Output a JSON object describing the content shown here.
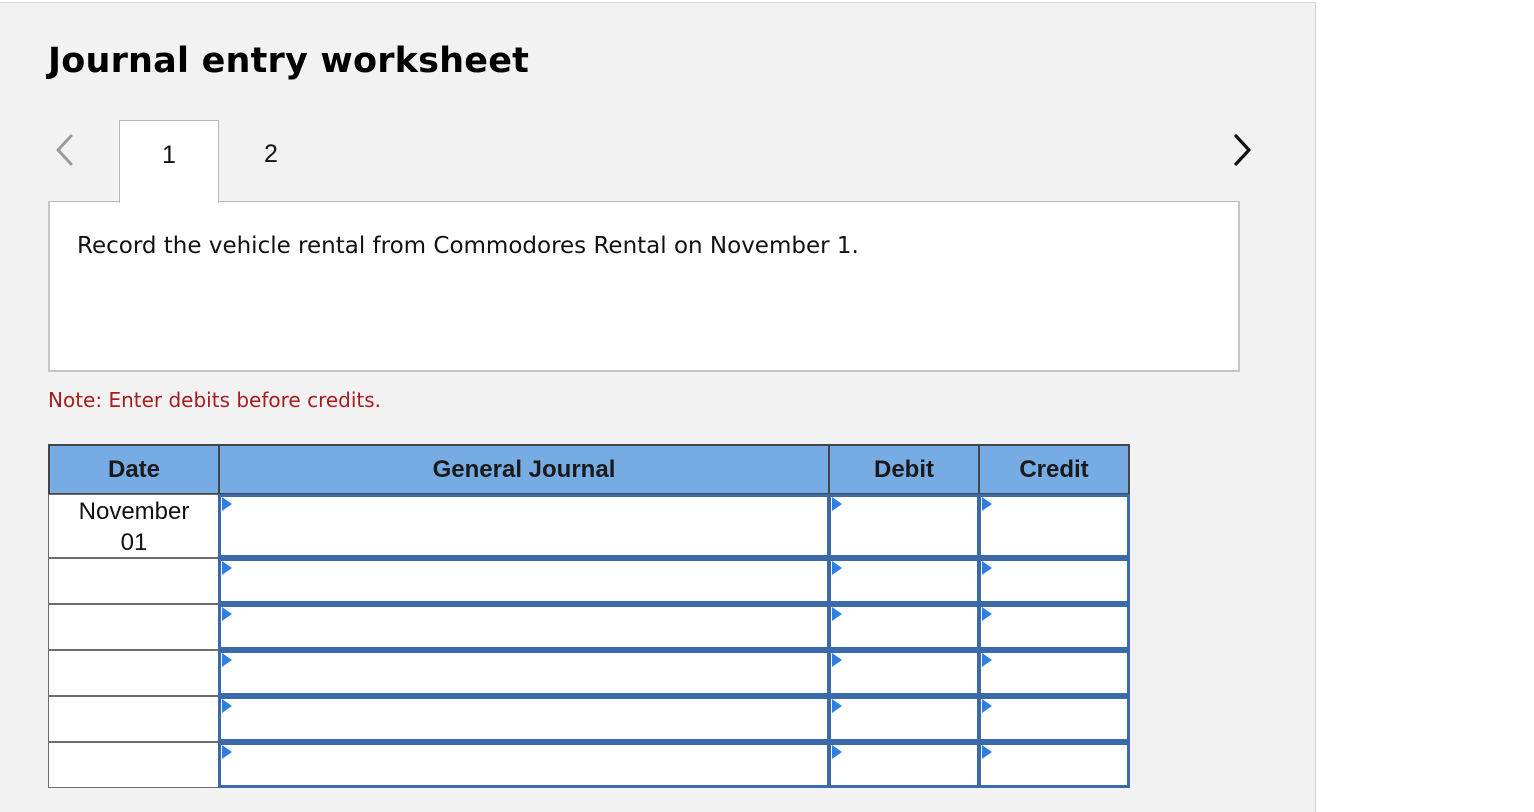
{
  "worksheet": {
    "title": "Journal entry worksheet",
    "tabs": [
      {
        "label": "1",
        "active": true
      },
      {
        "label": "2",
        "active": false
      }
    ],
    "prev_icon": "chevron-left-icon",
    "next_icon": "chevron-right-icon"
  },
  "question": {
    "text": "Record the vehicle rental from Commodores Rental on November 1."
  },
  "note": {
    "text": "Note: Enter debits before credits."
  },
  "journal": {
    "headers": {
      "date": "Date",
      "general_journal": "General Journal",
      "debit": "Debit",
      "credit": "Credit"
    },
    "rows": [
      {
        "date_month": "November",
        "date_day": "01",
        "account": "",
        "debit": "",
        "credit": ""
      },
      {
        "date_month": "",
        "date_day": "",
        "account": "",
        "debit": "",
        "credit": ""
      },
      {
        "date_month": "",
        "date_day": "",
        "account": "",
        "debit": "",
        "credit": ""
      },
      {
        "date_month": "",
        "date_day": "",
        "account": "",
        "debit": "",
        "credit": ""
      },
      {
        "date_month": "",
        "date_day": "",
        "account": "",
        "debit": "",
        "credit": ""
      },
      {
        "date_month": "",
        "date_day": "",
        "account": "",
        "debit": "",
        "credit": ""
      }
    ]
  },
  "colors": {
    "header_bg": "#76abe4",
    "input_border": "#3c6aa8",
    "note_text": "#a71d1d",
    "dropdown_indicator": "#2f7fe0"
  }
}
